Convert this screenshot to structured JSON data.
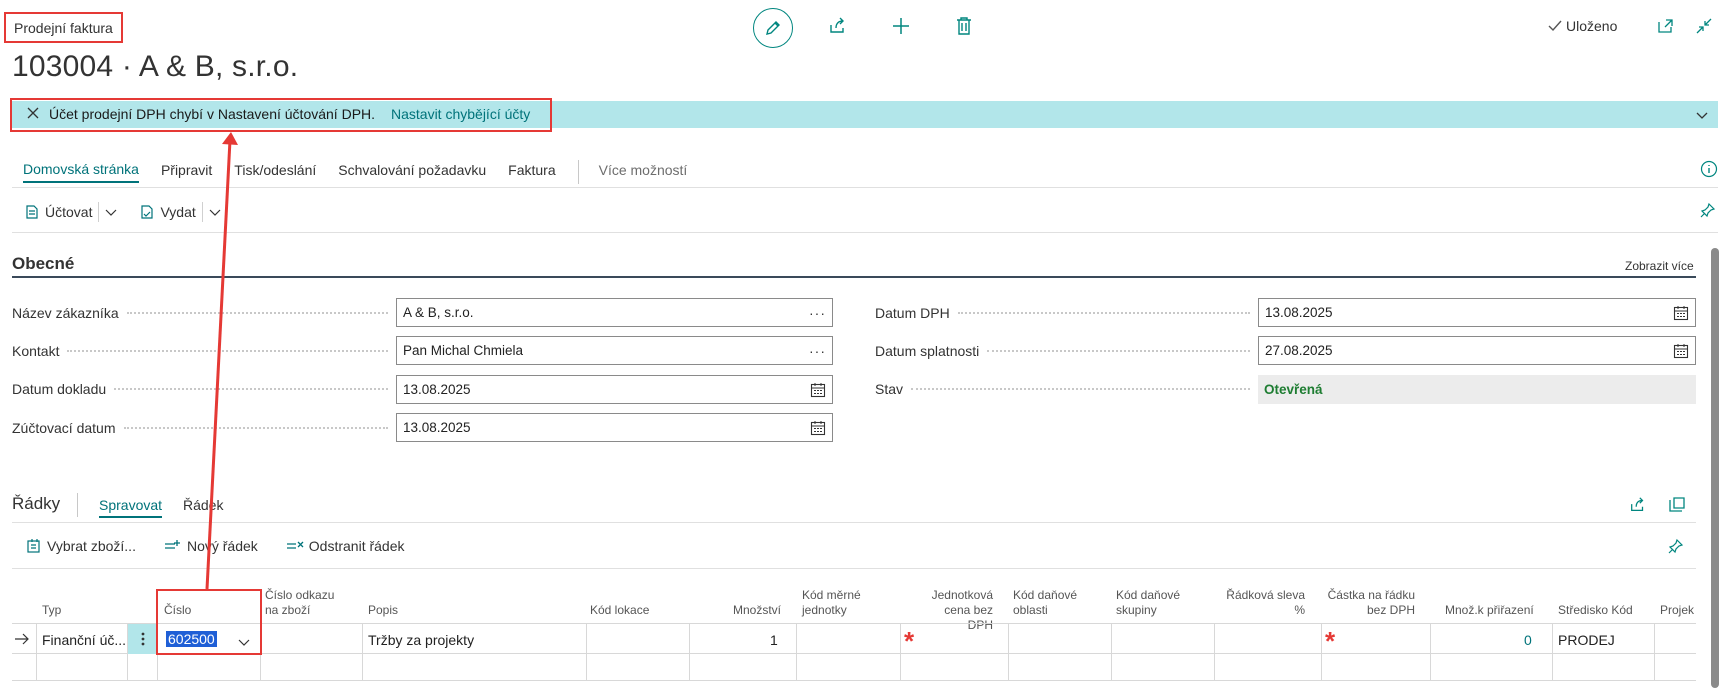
{
  "header": {
    "page_type": "Prodejní faktura",
    "title": "103004 · A & B, s.r.o.",
    "saved_label": "Uloženo"
  },
  "notification": {
    "message": "Účet prodejní DPH chybí v Nastavení účtování DPH.",
    "link": "Nastavit chybějící účty"
  },
  "tabs": [
    {
      "label": "Domovská stránka"
    },
    {
      "label": "Připravit"
    },
    {
      "label": "Tisk/odeslání"
    },
    {
      "label": "Schvalování požadavku"
    },
    {
      "label": "Faktura"
    }
  ],
  "tabs_more": "Více možností",
  "actions": {
    "post": "Účtovat",
    "release": "Vydat"
  },
  "general": {
    "title": "Obecné",
    "show_more": "Zobrazit více",
    "fields": {
      "customer_name": {
        "label": "Název zákazníka",
        "value": "A & B, s.r.o."
      },
      "contact": {
        "label": "Kontakt",
        "value": "Pan Michal Chmiela"
      },
      "document_date": {
        "label": "Datum dokladu",
        "value": "13.08.2025"
      },
      "posting_date": {
        "label": "Zúčtovací datum",
        "value": "13.08.2025"
      },
      "vat_date": {
        "label": "Datum DPH",
        "value": "13.08.2025"
      },
      "due_date": {
        "label": "Datum splatnosti",
        "value": "27.08.2025"
      },
      "status": {
        "label": "Stav",
        "value": "Otevřená"
      }
    }
  },
  "lines": {
    "title": "Řádky",
    "tab_manage": "Spravovat",
    "tab_line": "Řádek",
    "actions": {
      "select_items": "Vybrat zboží...",
      "new_line": "Nový řádek",
      "delete_line": "Odstranit řádek"
    },
    "columns": {
      "type": "Typ",
      "number": "Číslo",
      "item_ref_1": "Číslo odkazu",
      "item_ref_2": "na zboží",
      "description": "Popis",
      "location": "Kód lokace",
      "quantity": "Množství",
      "uom_1": "Kód měrné",
      "uom_2": "jednotky",
      "unit_price_1": "Jednotková",
      "unit_price_2": "cena bez DPH",
      "tax_area_1": "Kód daňové",
      "tax_area_2": "oblasti",
      "tax_group_1": "Kód daňové",
      "tax_group_2": "skupiny",
      "line_disc_1": "Řádková sleva",
      "line_disc_2": "%",
      "line_amount_1": "Částka na řádku",
      "line_amount_2": "bez DPH",
      "qty_assign": "Množ.k přiřazení",
      "cost_center": "Středisko Kód",
      "project": "Projek"
    },
    "row": {
      "type": "Finanční úč...",
      "number": "602500",
      "description": "Tržby za projekty",
      "quantity": "1",
      "qty_assign": "0",
      "cost_center": "PRODEJ"
    }
  },
  "colors": {
    "accent": "#00737a",
    "notification_bg": "#b2e6ea",
    "annotation": "#e53935",
    "status_open": "#1e7d32"
  }
}
